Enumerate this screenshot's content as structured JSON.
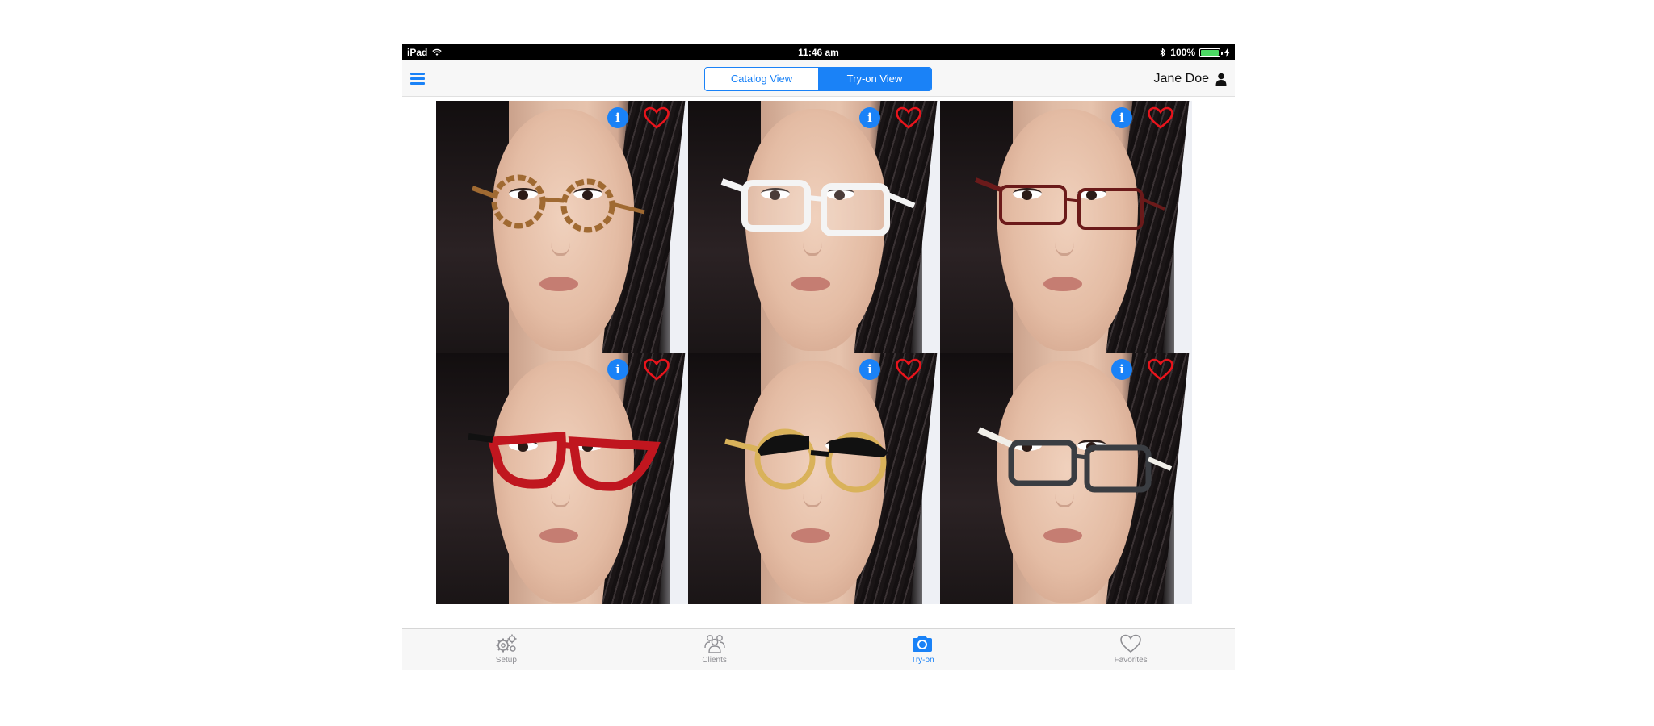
{
  "status_bar": {
    "device": "iPad",
    "time": "11:46 am",
    "battery": "100%"
  },
  "nav": {
    "segments": [
      "Catalog View",
      "Try-on View"
    ],
    "active_segment": 1,
    "user_name": "Jane Doe"
  },
  "grid": {
    "tiles": [
      {
        "info": "i",
        "frame_style": "round-tortoise",
        "frame_color": "#a06a32"
      },
      {
        "info": "i",
        "frame_style": "rect-clear",
        "frame_color": "#f4f4f4"
      },
      {
        "info": "i",
        "frame_style": "rect-thin",
        "frame_color": "#6b1a1a"
      },
      {
        "info": "i",
        "frame_style": "cat-eye",
        "frame_color": "#c0161f"
      },
      {
        "info": "i",
        "frame_style": "browline-round",
        "frame_color": "#111111"
      },
      {
        "info": "i",
        "frame_style": "rect-dark",
        "frame_color": "#3a3d42"
      }
    ]
  },
  "tabs": [
    {
      "label": "Setup",
      "icon": "gears-icon"
    },
    {
      "label": "Clients",
      "icon": "people-icon"
    },
    {
      "label": "Try-on",
      "icon": "camera-icon"
    },
    {
      "label": "Favorites",
      "icon": "heart-icon"
    }
  ],
  "active_tab": 2,
  "colors": {
    "accent": "#1a82f7",
    "heart": "#e8141c"
  }
}
